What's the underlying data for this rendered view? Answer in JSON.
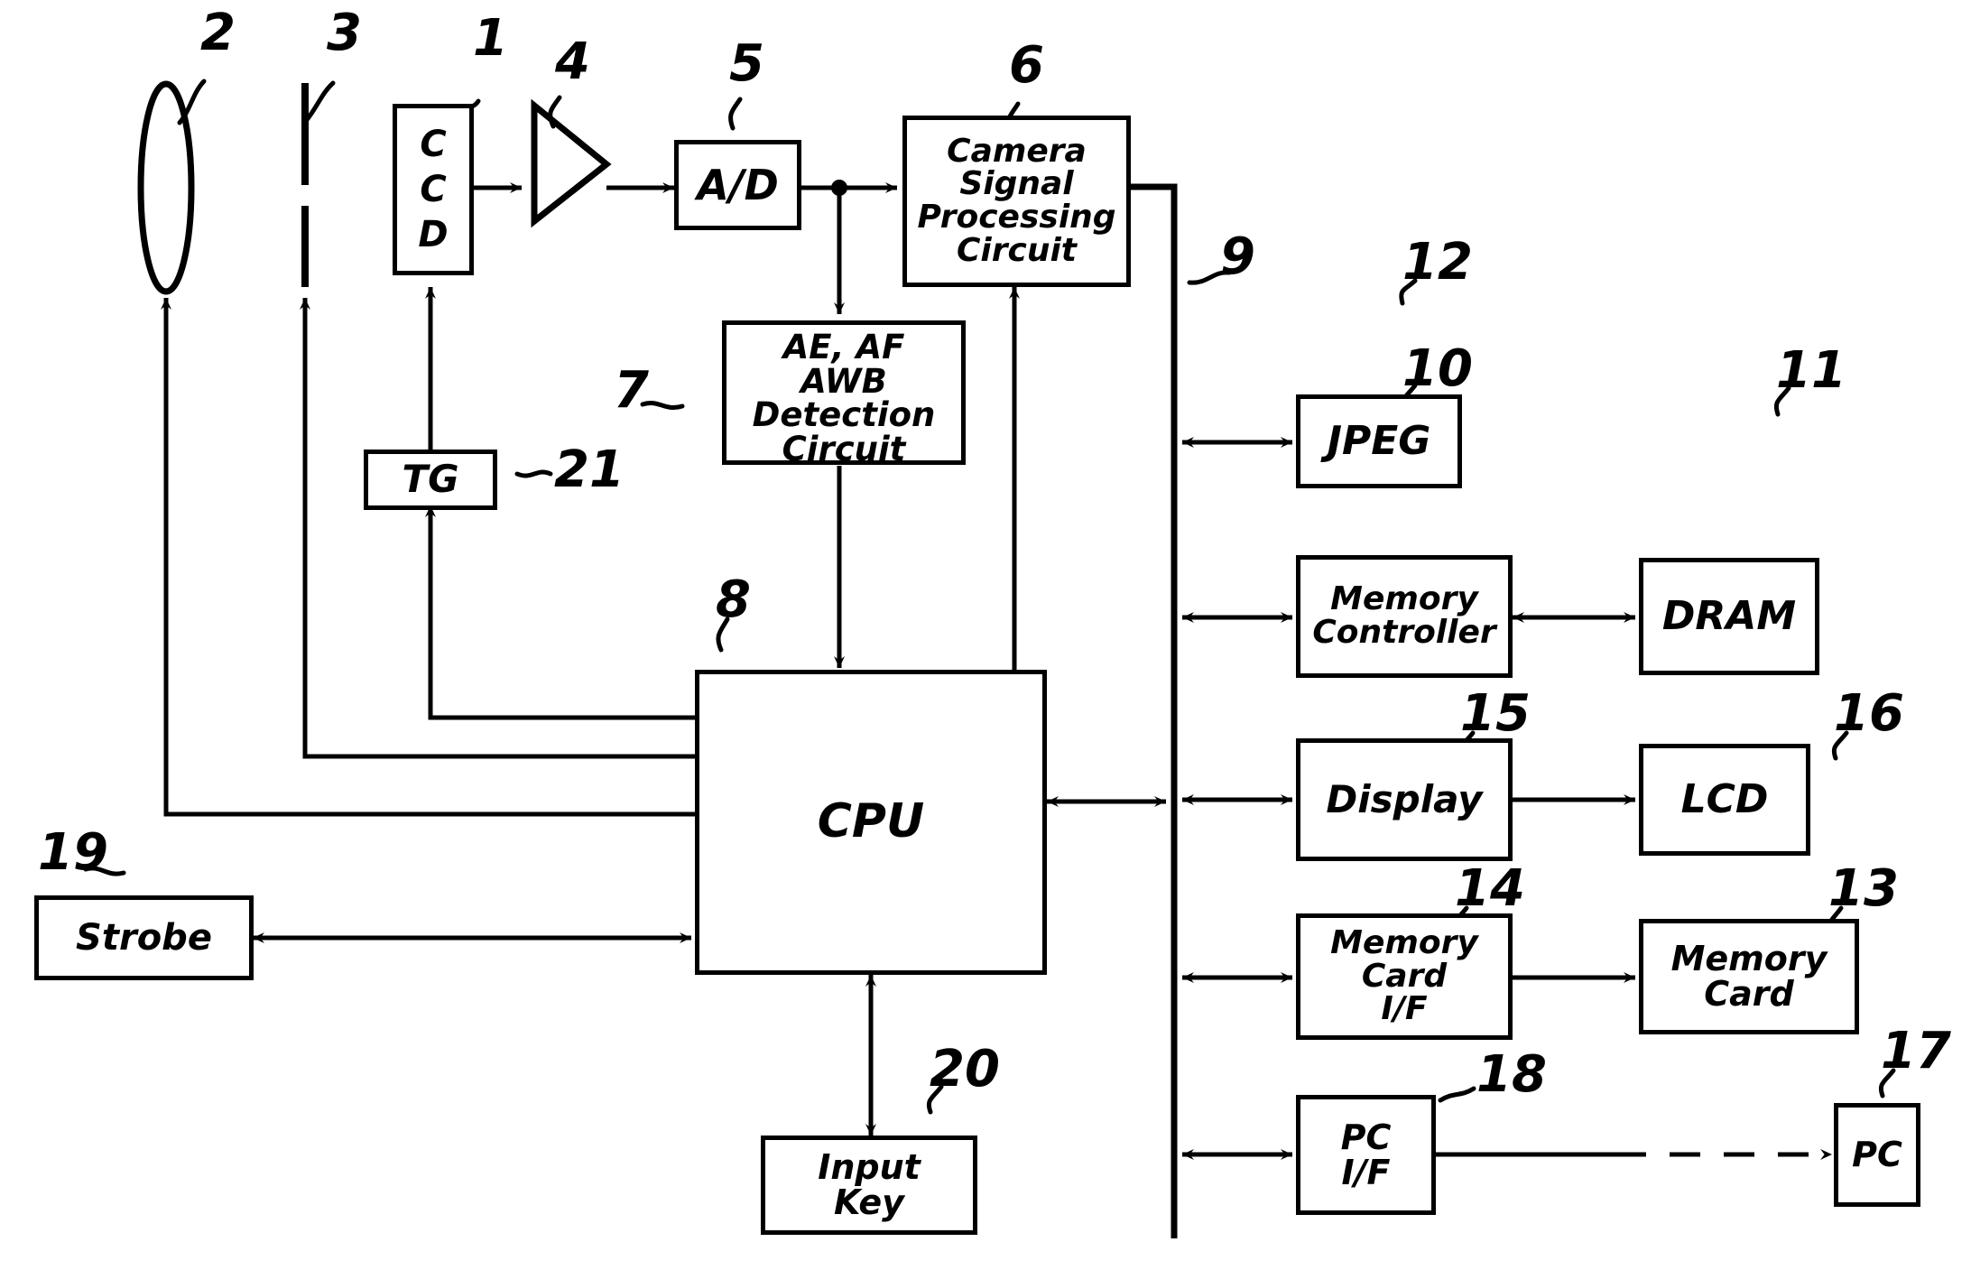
{
  "diagram": {
    "title": "Digital Camera Block Diagram",
    "type": "patent-block-diagram",
    "stroke_color": "#000000",
    "background_color": "#ffffff"
  },
  "blocks": {
    "ccd": {
      "label": "C\nC\nD",
      "ref": "1"
    },
    "lens": {
      "label": "",
      "ref": "2"
    },
    "aperture": {
      "label": "",
      "ref": "3"
    },
    "amplifier": {
      "label": "",
      "ref": "4"
    },
    "ad": {
      "label": "A/D",
      "ref": "5"
    },
    "camera_dsp": {
      "label": "Camera\nSignal\nProcessing\nCircuit",
      "ref": "6"
    },
    "detection": {
      "label": "AE, AF\nAWB\nDetection\nCircuit",
      "ref": "7"
    },
    "cpu": {
      "label": "CPU",
      "ref": "8"
    },
    "bus": {
      "label": "",
      "ref": "9"
    },
    "mem_ctrl": {
      "label": "Memory\nController",
      "ref": "10"
    },
    "dram": {
      "label": "DRAM",
      "ref": "11"
    },
    "jpeg": {
      "label": "JPEG",
      "ref": "12"
    },
    "mem_card": {
      "label": "Memory\nCard",
      "ref": "13"
    },
    "mem_card_if": {
      "label": "Memory\nCard\nI/F",
      "ref": "14"
    },
    "display": {
      "label": "Display",
      "ref": "15"
    },
    "lcd": {
      "label": "LCD",
      "ref": "16"
    },
    "pc": {
      "label": "PC",
      "ref": "17"
    },
    "pc_if": {
      "label": "PC\nI/F",
      "ref": "18"
    },
    "strobe": {
      "label": "Strobe",
      "ref": "19"
    },
    "input_key": {
      "label": "Input\nKey",
      "ref": "20"
    },
    "tg": {
      "label": "TG",
      "ref": "21"
    }
  },
  "reference_numerals": [
    "1",
    "2",
    "3",
    "4",
    "5",
    "6",
    "7",
    "8",
    "9",
    "10",
    "11",
    "12",
    "13",
    "14",
    "15",
    "16",
    "17",
    "18",
    "19",
    "20",
    "21"
  ],
  "connections": [
    {
      "from": "ccd",
      "to": "amplifier",
      "style": "solid",
      "arrow": "single"
    },
    {
      "from": "amplifier",
      "to": "ad",
      "style": "solid",
      "arrow": "single"
    },
    {
      "from": "ad",
      "to": "camera_dsp",
      "style": "solid",
      "arrow": "single"
    },
    {
      "from": "ad",
      "to": "detection",
      "style": "solid",
      "arrow": "single"
    },
    {
      "from": "detection",
      "to": "cpu",
      "style": "solid",
      "arrow": "single"
    },
    {
      "from": "cpu",
      "to": "camera_dsp",
      "style": "solid",
      "arrow": "single"
    },
    {
      "from": "camera_dsp",
      "to": "bus",
      "style": "solid",
      "arrow": "none"
    },
    {
      "from": "tg",
      "to": "ccd",
      "style": "solid",
      "arrow": "single"
    },
    {
      "from": "cpu",
      "to": "tg",
      "style": "solid",
      "arrow": "single"
    },
    {
      "from": "cpu",
      "to": "aperture",
      "style": "solid",
      "arrow": "single"
    },
    {
      "from": "cpu",
      "to": "lens",
      "style": "solid",
      "arrow": "single"
    },
    {
      "from": "cpu",
      "to": "strobe",
      "style": "solid",
      "arrow": "double"
    },
    {
      "from": "cpu",
      "to": "input_key",
      "style": "solid",
      "arrow": "double"
    },
    {
      "from": "cpu",
      "to": "bus",
      "style": "solid",
      "arrow": "double"
    },
    {
      "from": "bus",
      "to": "jpeg",
      "style": "solid",
      "arrow": "double"
    },
    {
      "from": "bus",
      "to": "mem_ctrl",
      "style": "solid",
      "arrow": "double"
    },
    {
      "from": "mem_ctrl",
      "to": "dram",
      "style": "solid",
      "arrow": "double"
    },
    {
      "from": "bus",
      "to": "display",
      "style": "solid",
      "arrow": "double"
    },
    {
      "from": "display",
      "to": "lcd",
      "style": "solid",
      "arrow": "single"
    },
    {
      "from": "bus",
      "to": "mem_card_if",
      "style": "solid",
      "arrow": "double"
    },
    {
      "from": "mem_card_if",
      "to": "mem_card",
      "style": "solid",
      "arrow": "single"
    },
    {
      "from": "bus",
      "to": "pc_if",
      "style": "solid",
      "arrow": "double"
    },
    {
      "from": "pc_if",
      "to": "pc",
      "style": "dashed",
      "arrow": "single"
    }
  ]
}
